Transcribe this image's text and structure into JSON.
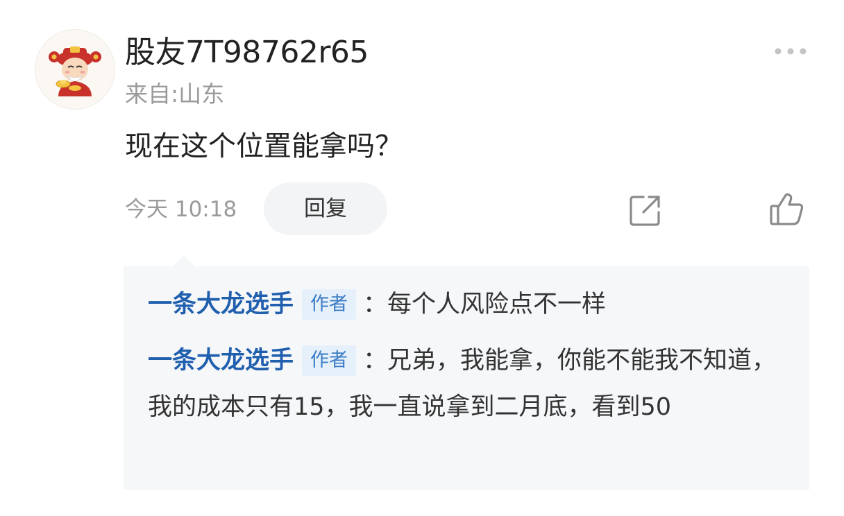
{
  "comment": {
    "user": {
      "name": "股友7T98762r65",
      "location": "来自:山东",
      "avatar": "fortune-god-avatar"
    },
    "text": "现在这个位置能拿吗？",
    "timestamp": "今天 10:18",
    "reply_label": "回复",
    "icons": {
      "more": "more-dots-icon",
      "share": "share-icon",
      "like": "thumbs-up-icon"
    }
  },
  "replies": [
    {
      "name": "一条大龙选手",
      "badge": "作者",
      "separator": "：",
      "text": "每个人风险点不一样"
    },
    {
      "name": "一条大龙选手",
      "badge": "作者",
      "separator": "：",
      "text": "兄弟，我能拿，你能不能我不知道，我的成本只有15，我一直说拿到二月底，看到50"
    }
  ],
  "colors": {
    "author_name": "#1f5fae",
    "badge_bg": "#e6f0fb",
    "badge_text": "#3a7cc4",
    "reply_box_bg": "#f6f7f9",
    "muted_text": "#9a9a9a",
    "reply_button_bg": "#f3f4f6"
  }
}
